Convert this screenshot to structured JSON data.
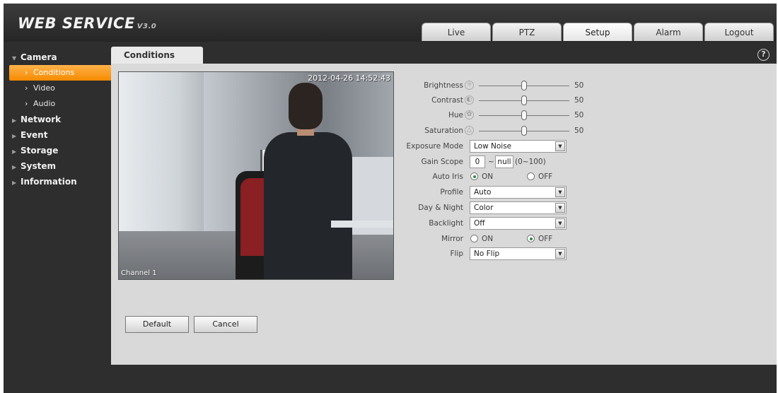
{
  "header": {
    "logo": "WEB  SERVICE",
    "logo_version": "V3.0",
    "tabs": [
      {
        "label": "Live",
        "active": false
      },
      {
        "label": "PTZ",
        "active": false
      },
      {
        "label": "Setup",
        "active": true
      },
      {
        "label": "Alarm",
        "active": false
      },
      {
        "label": "Logout",
        "active": false
      }
    ]
  },
  "sidebar": {
    "sections": [
      {
        "label": "Camera",
        "expanded": true,
        "items": [
          {
            "label": "Conditions",
            "active": true
          },
          {
            "label": "Video",
            "active": false
          },
          {
            "label": "Audio",
            "active": false
          }
        ]
      },
      {
        "label": "Network",
        "expanded": false
      },
      {
        "label": "Event",
        "expanded": false
      },
      {
        "label": "Storage",
        "expanded": false
      },
      {
        "label": "System",
        "expanded": false
      },
      {
        "label": "Information",
        "expanded": false
      }
    ]
  },
  "page": {
    "tab_title": "Conditions",
    "help_icon": "?"
  },
  "preview": {
    "timestamp": "2012-04-26 14:52:43",
    "channel": "Channel 1"
  },
  "form": {
    "brightness": {
      "label": "Brightness",
      "value": 50,
      "max": 100
    },
    "contrast": {
      "label": "Contrast",
      "value": 50,
      "max": 100
    },
    "hue": {
      "label": "Hue",
      "value": 50,
      "max": 100
    },
    "saturation": {
      "label": "Saturation",
      "value": 50,
      "max": 100
    },
    "exposure_mode": {
      "label": "Exposure Mode",
      "value": "Low Noise"
    },
    "gain_scope": {
      "label": "Gain Scope",
      "min": "0",
      "separator": "~",
      "max": "null",
      "range": "(0~100)"
    },
    "auto_iris": {
      "label": "Auto Iris",
      "on": "ON",
      "off": "OFF",
      "selected": "ON"
    },
    "profile": {
      "label": "Profile",
      "value": "Auto"
    },
    "day_night": {
      "label": "Day & Night",
      "value": "Color"
    },
    "backlight": {
      "label": "Backlight",
      "value": "Off"
    },
    "mirror": {
      "label": "Mirror",
      "on": "ON",
      "off": "OFF",
      "selected": "OFF"
    },
    "flip": {
      "label": "Flip",
      "value": "No Flip"
    }
  },
  "buttons": {
    "default": "Default",
    "cancel": "Cancel"
  },
  "colors": {
    "accent": "#f58a00",
    "radio_checked": "#2b8a3e"
  }
}
